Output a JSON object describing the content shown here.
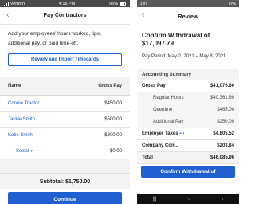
{
  "left": {
    "status": {
      "carrier": "Verizon",
      "time": "4:16 PM",
      "battery": "95%"
    },
    "nav": {
      "back_icon": "‹",
      "title": "Pay Contractors"
    },
    "intro": "Add your employees' hours worked, tips, additional pay, or paid time-off.",
    "review_button": "Review and Import Timecards",
    "table": {
      "col_name": "Name",
      "col_gross": "Gross Pay",
      "rows": [
        {
          "name": "Connie Tractor",
          "pay": "$450.00"
        },
        {
          "name": "Jackie Smith",
          "pay": "$500.00"
        },
        {
          "name": "Katie Smith",
          "pay": "$800.00"
        }
      ],
      "select_label": "Select",
      "select_pay": "$0.00"
    },
    "subtotal": "Subtotal: $1,750.00",
    "continue_button": "Continue"
  },
  "right": {
    "status": {
      "time": "1:07",
      "battery": "97%"
    },
    "nav": {
      "back_icon": "‹",
      "title": "Review"
    },
    "confirm_title": "Confirm Withdrawal of $17,097.79",
    "pay_period": "Pay Period: May 2, 2021 – May 8, 2021",
    "summary": {
      "header": "Accounting Summary",
      "gross": {
        "label": "Gross Pay",
        "value": "$41,076.60"
      },
      "regular": {
        "label": "Regular Hours",
        "value": "$40,361.60"
      },
      "overtime": {
        "label": "Overtime",
        "value": "$465.00"
      },
      "additional": {
        "label": "Additional Pay",
        "value": "$250.00"
      },
      "employer_taxes": {
        "label": "Employer Taxes",
        "dots": "•••",
        "value": "$4,805.52"
      },
      "company": {
        "label": "Company Con...",
        "value": "$203.84"
      },
      "total": {
        "label": "Total",
        "value": "$46,085.96"
      }
    },
    "confirm_button": "Confirm Withdrawal of",
    "android_nav": {
      "recent": "|||",
      "home": "○",
      "back": "‹"
    }
  }
}
